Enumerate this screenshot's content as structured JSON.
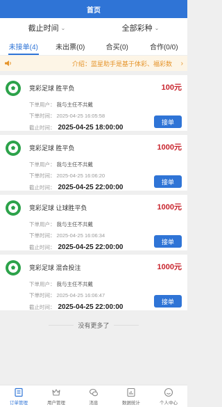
{
  "header": {
    "title": "首页"
  },
  "filters": [
    {
      "label": "截止时间"
    },
    {
      "label": "全部彩种"
    }
  ],
  "tabs": [
    {
      "label": "未接单(4)",
      "active": true
    },
    {
      "label": "未出票(0)",
      "active": false
    },
    {
      "label": "合买(0)",
      "active": false
    },
    {
      "label": "合作(0/0)",
      "active": false
    }
  ],
  "notice": {
    "text": "介绍：蓝星助手是基于体彩、福彩数"
  },
  "labels": {
    "user": "下单用户：",
    "order_time": "下单时间：",
    "deadline": "截止时间：",
    "accept": "接单"
  },
  "orders": [
    {
      "title": "竞彩足球 胜平负",
      "amount": "100元",
      "user": "我与主任不共戴",
      "order_time": "2025-04-25 16:05:58",
      "deadline": "2025-04-25 18:00:00"
    },
    {
      "title": "竞彩足球 胜平负",
      "amount": "1000元",
      "user": "我与主任不共戴",
      "order_time": "2025-04-25 16:06:20",
      "deadline": "2025-04-25 22:00:00"
    },
    {
      "title": "竞彩足球 让球胜平负",
      "amount": "1000元",
      "user": "我与主任不共戴",
      "order_time": "2025-04-25 16:06:34",
      "deadline": "2025-04-25 22:00:00"
    },
    {
      "title": "竞彩足球 混合投注",
      "amount": "1000元",
      "user": "我与主任不共戴",
      "order_time": "2025-04-25 16:06:47",
      "deadline": "2025-04-25 22:00:00"
    }
  ],
  "footer_text": "没有更多了",
  "tabbar": [
    {
      "label": "订单管理",
      "icon": "order-icon",
      "active": true
    },
    {
      "label": "用户管理",
      "icon": "crown-icon",
      "active": false
    },
    {
      "label": "消息",
      "icon": "chat-icon",
      "active": false
    },
    {
      "label": "数据统计",
      "icon": "chart-icon",
      "active": false
    },
    {
      "label": "个人中心",
      "icon": "smile-icon",
      "active": false
    }
  ],
  "colors": {
    "primary": "#2f74d6",
    "amount": "#c8232c",
    "notice": "#e5942b",
    "ball": "#2ca24a"
  }
}
